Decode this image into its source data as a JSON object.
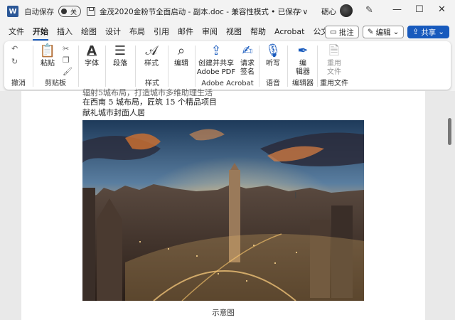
{
  "titlebar": {
    "logo": "W",
    "autosave_label": "自动保存",
    "toggle_state": "关",
    "doc_title": "金茂2020金粉节全面启动 - 副本.doc  -  兼容性模式 • 已保存 ∨",
    "username": "砺心",
    "icons": [
      "word-icon",
      "save-icon",
      "search-icon",
      "pen-icon",
      "minimize-icon",
      "restore-icon",
      "close-icon"
    ]
  },
  "tabs": [
    "文件",
    "开始",
    "插入",
    "绘图",
    "设计",
    "布局",
    "引用",
    "邮件",
    "审阅",
    "视图",
    "帮助",
    "Acrobat",
    "公文"
  ],
  "active_tab": "开始",
  "tab_actions": {
    "comment": "批注",
    "edit": "编辑",
    "share": "共享"
  },
  "ribbon": {
    "undo_group": "撤消",
    "clipboard_group": "剪贴板",
    "paste": "粘贴",
    "font": "字体",
    "paragraph": "段落",
    "styles": "样式",
    "styles_group": "样式",
    "editing": "编辑",
    "acrobat_create": "创建并共享",
    "acrobat_create2": "Adobe PDF",
    "acrobat_request": "请求",
    "acrobat_request2": "签名",
    "acrobat_group": "Adobe Acrobat",
    "dictate": "听写",
    "voice_group": "语音",
    "editor": "编",
    "editor2": "辑器",
    "editor_group": "编辑器",
    "reuse": "重用",
    "reuse2": "文件",
    "reuse_group": "重用文件"
  },
  "document": {
    "line1": "辐射5城布局，打造城市多维助理生活",
    "line2": "在西南 5 城布局，匠筑 15 个精品项目",
    "line3": "献礼城市封面人居",
    "caption": "示意图"
  },
  "colors": {
    "accent": "#185abd",
    "ribbon_bg": "#ffffff",
    "chrome_bg": "#f3f3f3"
  }
}
